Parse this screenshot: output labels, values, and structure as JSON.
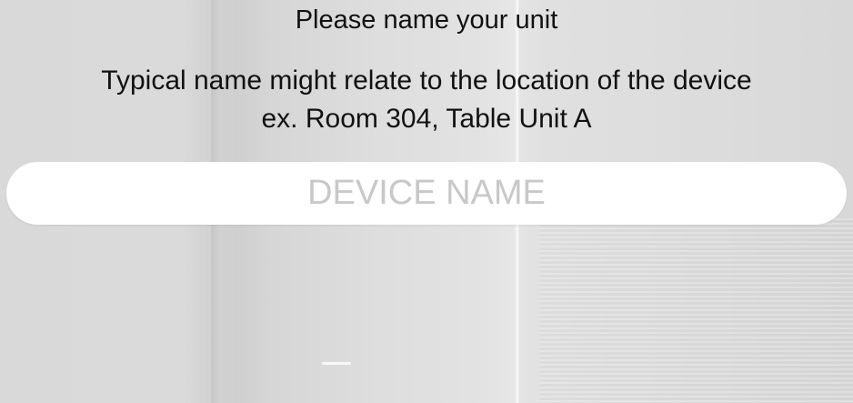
{
  "prompt": {
    "title": "Please name your unit",
    "hint_line1": "Typical name might relate to the location of the device",
    "hint_line2": "ex. Room 304, Table Unit A"
  },
  "device_name_field": {
    "value": "",
    "placeholder": "DEVICE NAME"
  }
}
